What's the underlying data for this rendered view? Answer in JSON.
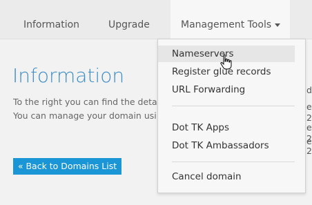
{
  "nav": {
    "tabs": [
      {
        "label": "Information"
      },
      {
        "label": "Upgrade"
      },
      {
        "label": "Management Tools"
      }
    ]
  },
  "main": {
    "heading": "Information",
    "lines": [
      "To the right you can find the deta",
      "You can manage your domain usi"
    ],
    "back_button": "« Back to Domains List",
    "right_fragments": [
      "d",
      "e",
      "2",
      "e",
      "2",
      "e",
      "2"
    ]
  },
  "dropdown": {
    "items": [
      "Nameservers",
      "Register glue records",
      "URL Forwarding",
      "Dot TK Apps",
      "Dot TK Ambassadors",
      "Cancel domain"
    ]
  },
  "colors": {
    "accent": "#3b8dc9",
    "button": "#1a95d5"
  }
}
